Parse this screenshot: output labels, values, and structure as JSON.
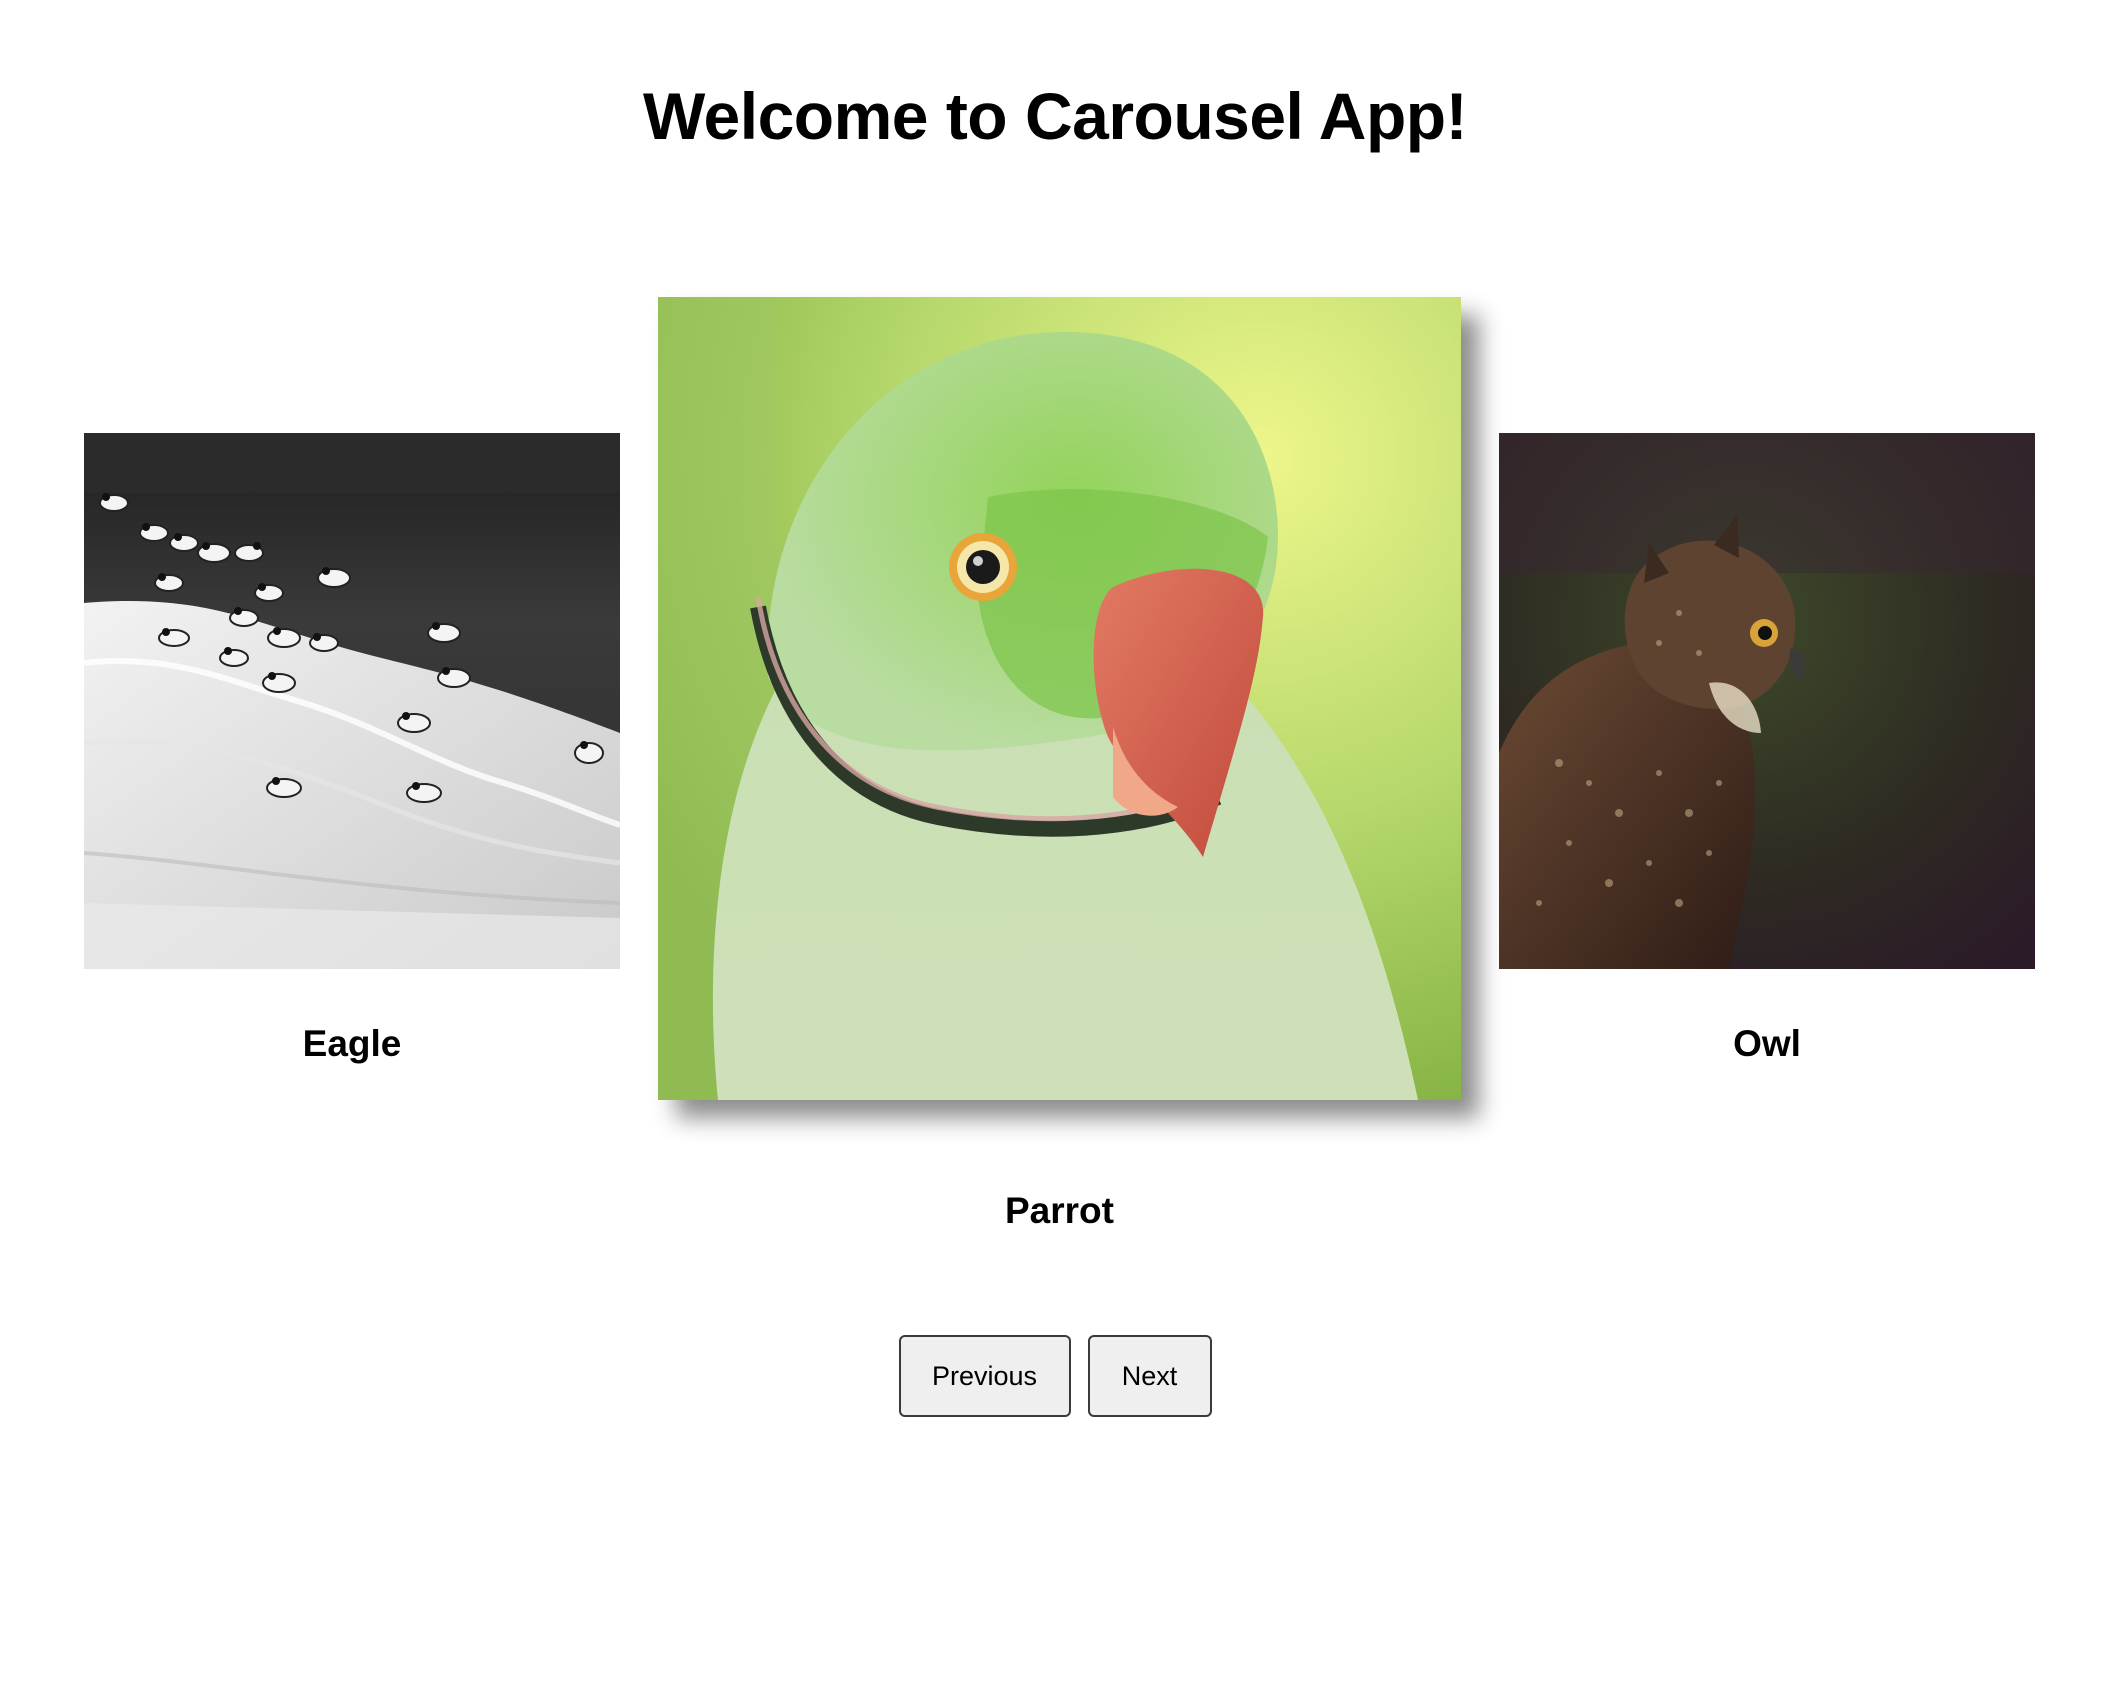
{
  "header": {
    "title": "Welcome to Carousel App!"
  },
  "carousel": {
    "slides": [
      {
        "caption": "Eagle",
        "position": "previous",
        "image": "black-and-white seagulls on beach"
      },
      {
        "caption": "Parrot",
        "position": "active",
        "image": "green ring-necked parrot close-up"
      },
      {
        "caption": "Owl",
        "position": "next",
        "image": "brown horned owl on dark background"
      }
    ]
  },
  "controls": {
    "previous_label": "Previous",
    "next_label": "Next"
  }
}
